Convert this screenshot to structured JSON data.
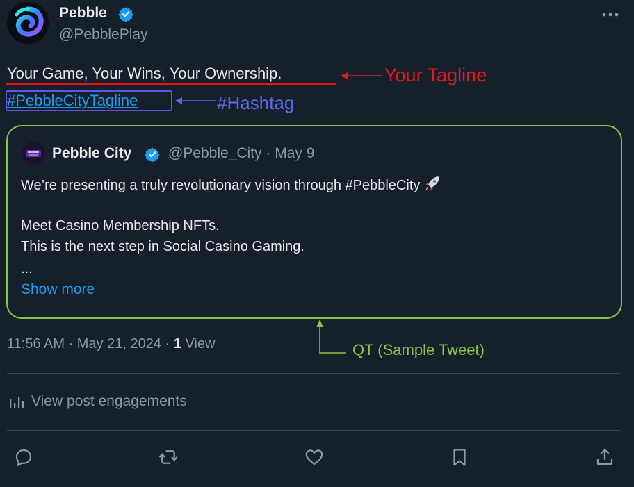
{
  "account": {
    "name": "Pebble",
    "handle": "@PebblePlay",
    "avatar_icon": "pebble-swirl-logo",
    "verified_icon": "verified-badge-icon",
    "more_icon": "more-horizontal-icon"
  },
  "post": {
    "tagline": "Your Game, Your Wins, Your Ownership.",
    "hashtag": "#PebbleCityTagline"
  },
  "annotations": {
    "tagline_note": "Your Tagline",
    "hashtag_note": "#Hashtag",
    "qt_note": "QT (Sample Tweet)",
    "colors": {
      "tagline": "#e5161d",
      "hashtag": "#5c68f0",
      "qt": "#8bc34a"
    }
  },
  "quote": {
    "name": "Pebble City",
    "handle_date": "@Pebble_City · May 9",
    "line1": "We’re presenting a truly revolutionary vision through #PebbleCity",
    "line2": "Meet Casino Membership NFTs.",
    "line3": "This is the next step in Social Casino Gaming.",
    "line4": "...",
    "show_more": "Show more",
    "emoji_icon": "rocket-icon"
  },
  "meta": {
    "timestamp": "11:56 AM · May 21, 2024 · ",
    "views_count": "1",
    "views_label": " View"
  },
  "engagements": {
    "label": "View post engagements",
    "icon": "analytics-bars-icon"
  },
  "actions": [
    {
      "name": "reply",
      "icon": "reply-icon"
    },
    {
      "name": "repost",
      "icon": "repost-icon"
    },
    {
      "name": "like",
      "icon": "heart-icon"
    },
    {
      "name": "bookmark",
      "icon": "bookmark-icon"
    },
    {
      "name": "share",
      "icon": "share-icon"
    }
  ],
  "theme": {
    "background": "#15202b",
    "text": "#e7e9ea",
    "muted": "#8b98a5",
    "accent": "#1d9bf0",
    "border": "#38444d"
  }
}
